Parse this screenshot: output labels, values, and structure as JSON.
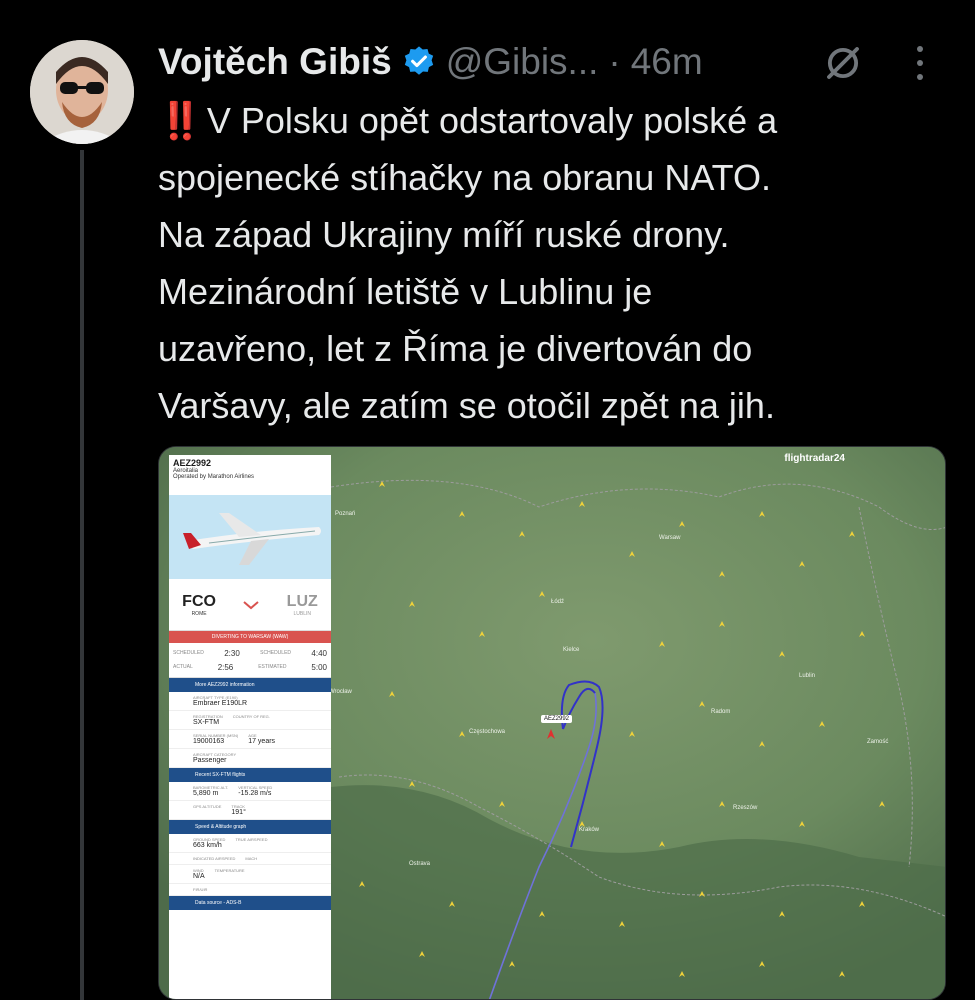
{
  "tweet": {
    "author_name": "Vojtěch Gibiš",
    "handle": "@Gibis...",
    "separator": "·",
    "time": "46m",
    "emoji": "‼️",
    "text_lines": [
      "V Polsku opět odstartovaly polské a",
      "spojenecké stíhačky na obranu NATO.",
      "Na západ Ukrajiny míří ruské drony.",
      "Mezinárodní letiště v Lublinu je",
      "uzavřeno, let z Říma je divertován do",
      "Varšavy, ale zatím se otočil zpět na jih."
    ],
    "icons": [
      "verified-badge-icon",
      "mute-icon",
      "more-options-icon"
    ]
  },
  "screenshot": {
    "brand": "flightradar24",
    "panel": {
      "flight_id": "AEZ2992",
      "airline": "Aeroitalia",
      "operated_by": "Operated by Marathon Airlines",
      "origin": "FCO",
      "origin_city": "ROME",
      "destination": "LUZ",
      "destination_city": "LUBLIN",
      "status": "DIVERTING TO WARSAW (WAW)",
      "scheduled_label": "SCHEDULED",
      "actual_label": "ACTUAL",
      "estimated_label": "ESTIMATED",
      "dep_scheduled": "2:30",
      "dep_actual": "2:56",
      "arr_scheduled": "4:40",
      "arr_estimated": "5:00",
      "more_info": "More AEZ2992 information",
      "aircraft_label": "AIRCRAFT TYPE (E190)",
      "aircraft": "Embraer E190LR",
      "registration_label": "REGISTRATION",
      "registration": "SX-FTM",
      "country_label": "COUNTRY OF REG.",
      "serial_label": "SERIAL NUMBER (MSN)",
      "serial": "19000163",
      "age_label": "AGE",
      "age": "17 years",
      "category_label": "AIRCRAFT CATEGORY",
      "category": "Passenger",
      "recent_flights": "Recent SX-FTM flights",
      "baro_label": "BAROMETRIC ALT.",
      "baro_alt": "5,890 m",
      "vspeed_label": "VERTICAL SPEED",
      "vspeed": "-15.28 m/s",
      "gps_label": "GPS ALTITUDE",
      "track_label": "TRACK",
      "track": "191°",
      "speed_graph": "Speed & Altitude graph",
      "ground_speed_label": "GROUND SPEED",
      "ground_speed": "663 km/h",
      "true_airspeed_label": "TRUE AIRSPEED",
      "ias_label": "INDICATED AIRSPEED",
      "mach_label": "MACH",
      "wind_label": "WIND",
      "wind": "N/A",
      "temperature_label": "TEMPERATURE",
      "fir_label": "FIR/UIR",
      "data_source": "Data source - ADS-B"
    },
    "map": {
      "aircraft_tag": "AEZ2992",
      "cities": [
        "Poznań",
        "Warsaw",
        "Łódź",
        "Wrocław",
        "Kraków",
        "Lublin",
        "Ostrava",
        "Częstochowa",
        "Radom",
        "Kielce",
        "Zamość",
        "Rzeszów"
      ]
    }
  }
}
